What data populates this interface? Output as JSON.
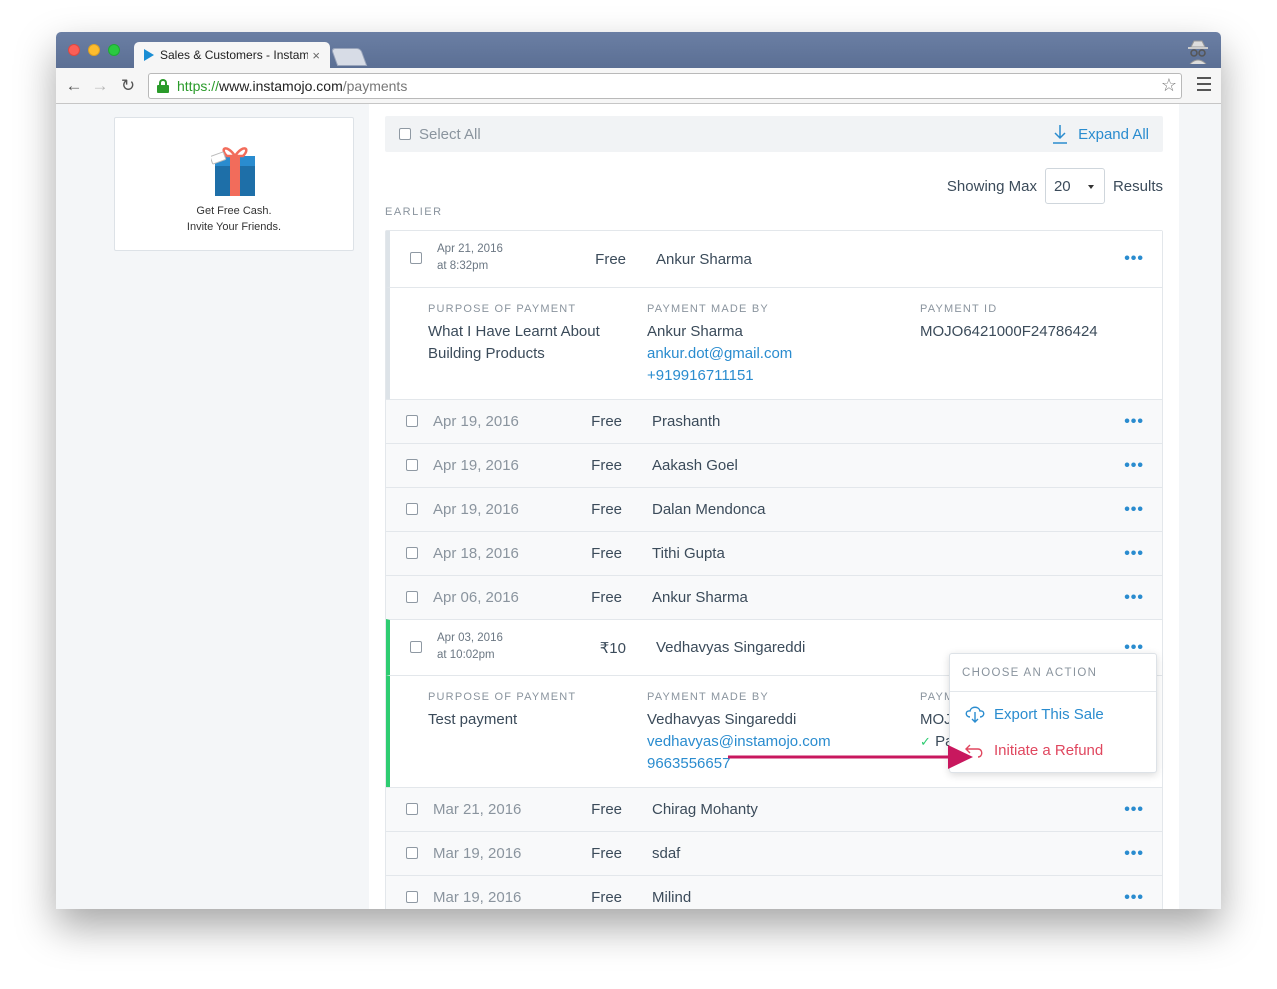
{
  "browser": {
    "tab_title": "Sales & Customers - Instamojo",
    "tab_close": "×",
    "url_proto": "https://",
    "url_host": "www.instamojo.com",
    "url_path": "/payments"
  },
  "promo": {
    "line1": "Get Free Cash.",
    "line2": "Invite Your Friends."
  },
  "toolbar": {
    "select_all": "Select All",
    "expand_all": "Expand All",
    "showing_label": "Showing Max",
    "results_per_page": "20",
    "results_label": "Results"
  },
  "section_label": "EARLIER",
  "expanded1": {
    "date": "Apr 21, 2016",
    "time": "at 8:32pm",
    "price": "Free",
    "name": "Ankur Sharma",
    "purpose_label": "PURPOSE OF PAYMENT",
    "purpose_line1": "What I Have Learnt About",
    "purpose_line2": "Building Products",
    "made_by_label": "PAYMENT MADE BY",
    "made_by_name": "Ankur Sharma",
    "made_by_email": "ankur.dot@gmail.com",
    "made_by_phone": "+919916711151",
    "id_label": "PAYMENT ID",
    "payment_id": "MOJO6421000F24786424"
  },
  "rows_a": [
    {
      "date": "Apr 19, 2016",
      "price": "Free",
      "name": "Prashanth"
    },
    {
      "date": "Apr 19, 2016",
      "price": "Free",
      "name": "Aakash Goel"
    },
    {
      "date": "Apr 19, 2016",
      "price": "Free",
      "name": "Dalan Mendonca"
    },
    {
      "date": "Apr 18, 2016",
      "price": "Free",
      "name": "Tithi Gupta"
    },
    {
      "date": "Apr 06, 2016",
      "price": "Free",
      "name": "Ankur Sharma"
    }
  ],
  "expanded2": {
    "date": "Apr 03, 2016",
    "time": "at 10:02pm",
    "price": "₹10",
    "name": "Vedhavyas Singareddi",
    "purpose_label": "PURPOSE OF PAYMENT",
    "purpose": "Test payment",
    "made_by_label": "PAYMENT MADE BY",
    "made_by_name": "Vedhavyas Singareddi",
    "made_by_email": "vedhavyas@instamojo.com",
    "made_by_phone": "9663556657",
    "id_label_partial": "PAYM",
    "payment_id_partial": "MOJ",
    "status_partial": "Pa"
  },
  "rows_b": [
    {
      "date": "Mar 21, 2016",
      "price": "Free",
      "name": "Chirag Mohanty"
    },
    {
      "date": "Mar 19, 2016",
      "price": "Free",
      "name": "sdaf"
    },
    {
      "date": "Mar 19, 2016",
      "price": "Free",
      "name": "Milind"
    }
  ],
  "more_glyph": "•••",
  "action_menu": {
    "title": "CHOOSE AN ACTION",
    "export": "Export This Sale",
    "refund": "Initiate a Refund"
  },
  "colors": {
    "link_blue": "#2a8ccf",
    "refund_red": "#e0475f",
    "paid_green": "#2ecc71",
    "annotation_arrow": "#c8175e"
  }
}
